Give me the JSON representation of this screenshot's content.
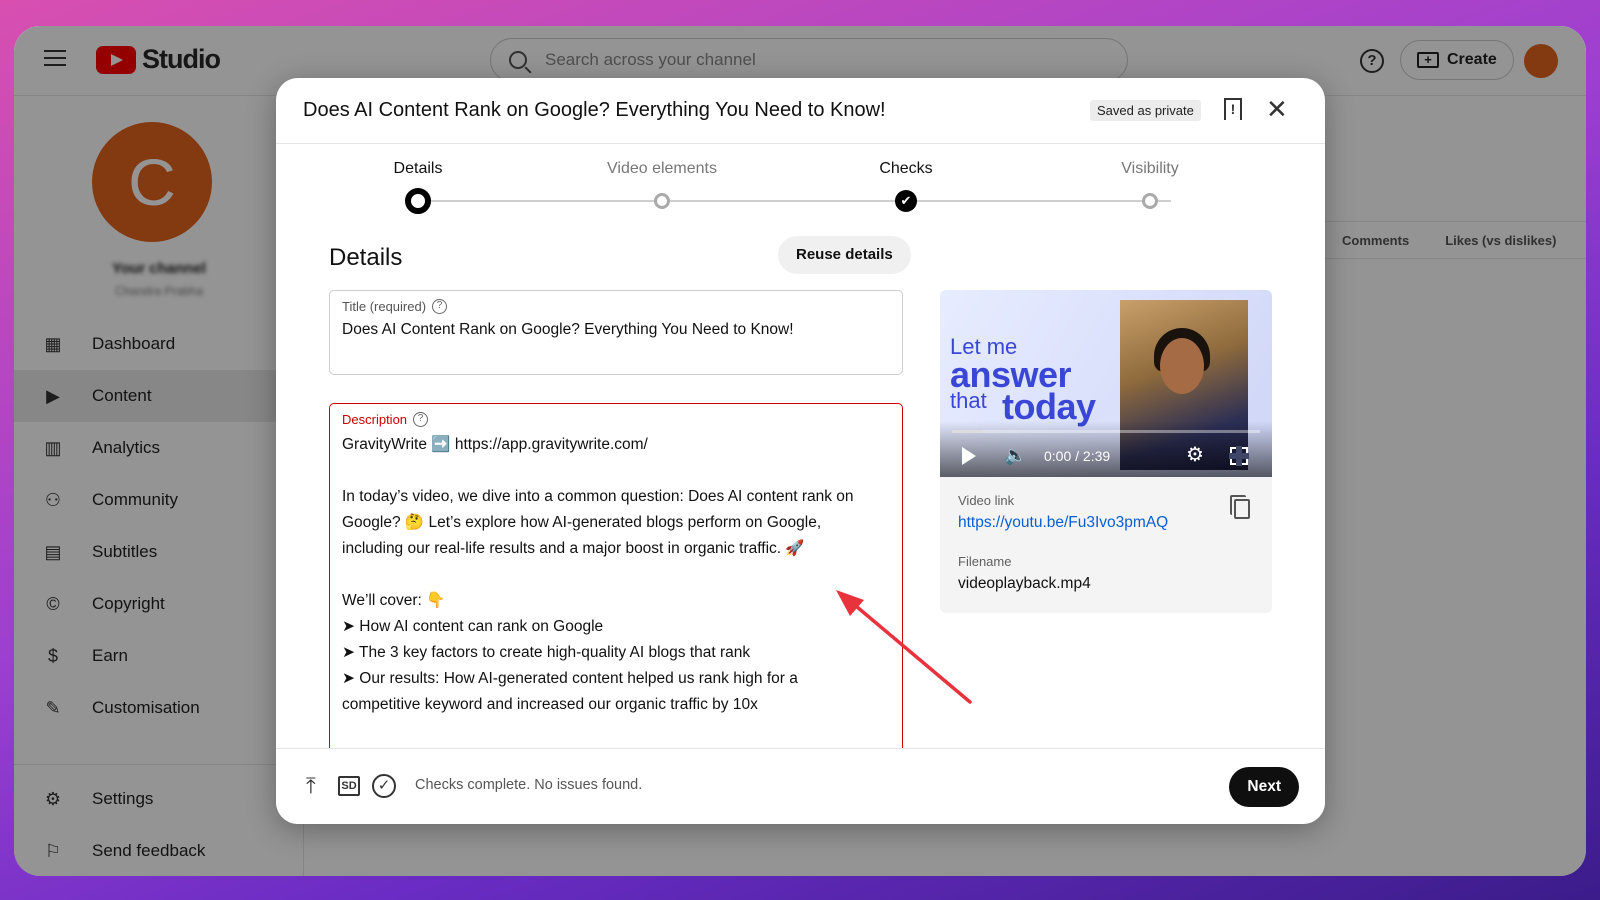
{
  "studio": {
    "logo_text": "Studio",
    "search_placeholder": "Search across your channel",
    "create_label": "Create",
    "avatar_initial": "C",
    "channel_name": "Your channel",
    "channel_handle": "Chandra Prabha",
    "nav": [
      {
        "label": "Dashboard",
        "icon": "dashboard-icon"
      },
      {
        "label": "Content",
        "icon": "content-icon"
      },
      {
        "label": "Analytics",
        "icon": "analytics-icon"
      },
      {
        "label": "Community",
        "icon": "community-icon"
      },
      {
        "label": "Subtitles",
        "icon": "subtitles-icon"
      },
      {
        "label": "Copyright",
        "icon": "copyright-icon"
      },
      {
        "label": "Earn",
        "icon": "earn-icon"
      },
      {
        "label": "Customisation",
        "icon": "customisation-icon"
      }
    ],
    "nav_bottom": [
      {
        "label": "Settings",
        "icon": "settings-icon"
      },
      {
        "label": "Send feedback",
        "icon": "feedback-icon"
      }
    ],
    "table_headers": [
      "Comments",
      "Likes (vs dislikes)"
    ]
  },
  "modal": {
    "title": "Does AI Content Rank on Google? Everything You Need to Know!",
    "saved_badge": "Saved as private",
    "steps": [
      {
        "label": "Details",
        "state": "current"
      },
      {
        "label": "Video elements",
        "state": "empty"
      },
      {
        "label": "Checks",
        "state": "done"
      },
      {
        "label": "Visibility",
        "state": "empty"
      }
    ],
    "section_title": "Details",
    "reuse_label": "Reuse details",
    "title_field": {
      "label": "Title (required)",
      "value": "Does AI Content Rank on Google? Everything You Need to Know!"
    },
    "description_field": {
      "label": "Description",
      "lines": [
        "GravityWrite ➡️ https://app.gravitywrite.com/",
        "",
        "In today’s video, we dive into a common question: Does AI content rank on",
        "Google? 🤔 Let’s explore how AI-generated blogs perform on Google,",
        "including our real-life results and a major boost in organic traffic. 🚀",
        "",
        "We’ll cover: 👇",
        "➤ How AI content can rank on Google",
        "➤ The 3 key factors to create high-quality AI blogs that rank",
        "➤ Our results: How AI-generated content helped us rank high for a",
        "competitive keyword and increased our organic traffic by 10x"
      ]
    },
    "preview": {
      "thumb_lines": [
        "Let me",
        "answer",
        "that",
        "today"
      ],
      "time": "0:00 / 2:39",
      "progress": 0.1,
      "video_link_label": "Video link",
      "video_link": "https://youtu.be/Fu3Ivo3pmAQ",
      "filename_label": "Filename",
      "filename": "videoplayback.mp4"
    },
    "footer": {
      "sd_label": "SD",
      "status": "Checks complete. No issues found.",
      "next_label": "Next"
    },
    "annotation_color": "#e8323c"
  }
}
